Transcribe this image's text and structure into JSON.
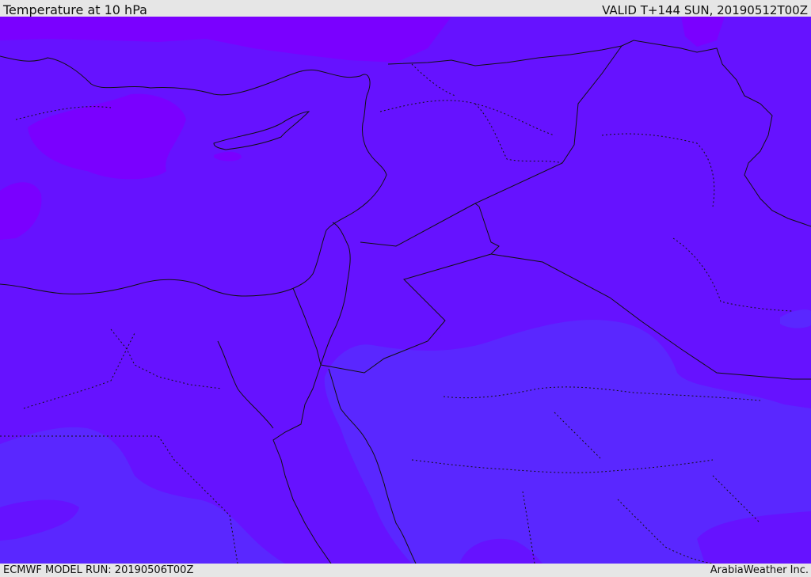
{
  "header": {
    "title": "Temperature at 10 hPa",
    "valid_time": "VALID T+144 SUN, 20190512T00Z"
  },
  "footer": {
    "model_run": "ECMWF MODEL RUN: 20190506T00Z",
    "credit": "ArabiaWeather Inc."
  },
  "map": {
    "colors": {
      "base": "#6612ff",
      "cold_band": "#7a00ff",
      "warm_band": "#5a27ff",
      "border_line": "#111111"
    }
  }
}
